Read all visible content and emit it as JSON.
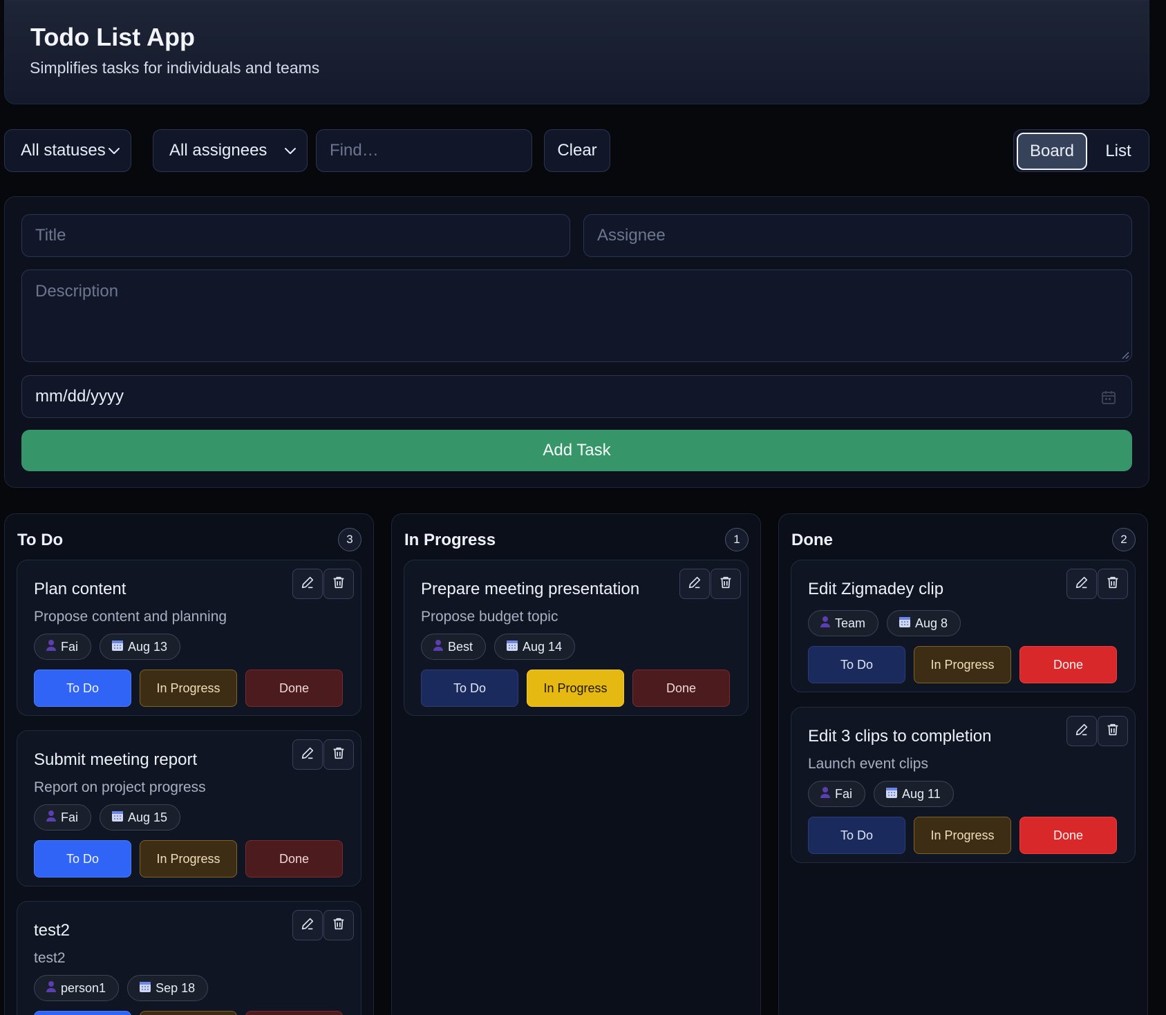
{
  "header": {
    "title": "Todo List App",
    "subtitle": "Simplifies tasks for individuals and teams"
  },
  "toolbar": {
    "status_filter": "All statuses",
    "assignee_filter": "All assignees",
    "find_placeholder": "Find…",
    "clear_label": "Clear",
    "view_board": "Board",
    "view_list": "List",
    "active_view": "Board"
  },
  "form": {
    "title_placeholder": "Title",
    "assignee_placeholder": "Assignee",
    "description_placeholder": "Description",
    "date_value": "mm/dd/yyyy",
    "add_label": "Add Task"
  },
  "status_labels": {
    "todo": "To Do",
    "progress": "In Progress",
    "done": "Done"
  },
  "columns": [
    {
      "title": "To Do",
      "count": "3",
      "cards": [
        {
          "title": "Plan content",
          "description": "Propose content and planning",
          "assignee": "Fai",
          "date": "Aug 13",
          "status": "todo"
        },
        {
          "title": "Submit meeting report",
          "description": "Report on project progress",
          "assignee": "Fai",
          "date": "Aug 15",
          "status": "todo"
        },
        {
          "title": "test2",
          "description": "test2",
          "assignee": "person1",
          "date": "Sep 18",
          "status": "todo"
        }
      ]
    },
    {
      "title": "In Progress",
      "count": "1",
      "cards": [
        {
          "title": "Prepare meeting presentation",
          "description": "Propose budget topic",
          "assignee": "Best",
          "date": "Aug 14",
          "status": "progress"
        }
      ]
    },
    {
      "title": "Done",
      "count": "2",
      "cards": [
        {
          "title": "Edit Zigmadey clip",
          "description": "",
          "assignee": "Team",
          "date": "Aug 8",
          "status": "done"
        },
        {
          "title": "Edit 3 clips to completion",
          "description": "Launch event clips",
          "assignee": "Fai",
          "date": "Aug 11",
          "status": "done"
        }
      ]
    }
  ],
  "colors": {
    "accent_green": "#37956a",
    "todo_active": "#2f64f6",
    "progress_active": "#e6b812",
    "done_active": "#d9282a"
  },
  "icons": [
    "chevron-down-icon",
    "calendar-icon",
    "resize-handle-icon",
    "pencil-icon",
    "trash-icon",
    "person-icon"
  ]
}
